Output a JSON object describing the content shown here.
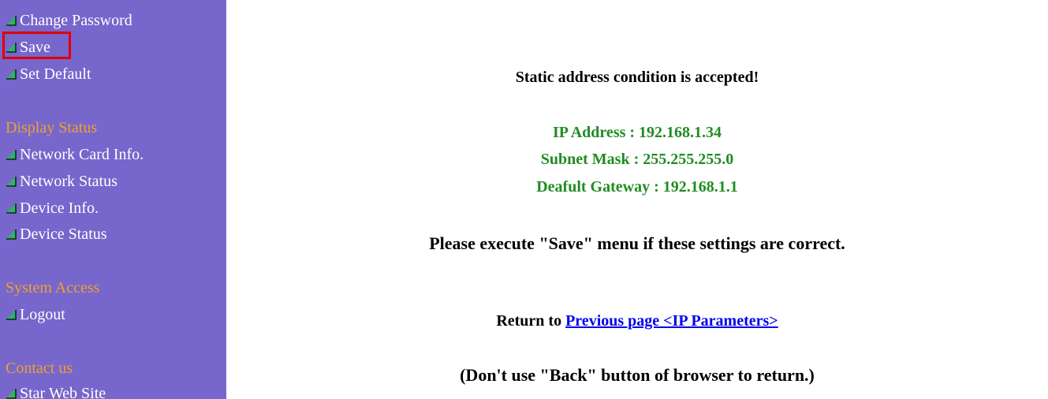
{
  "sidebar": {
    "background": "#7766cc",
    "header_color": "#f0a030",
    "bullet_icon": "green-triangle-bullet-icon",
    "items": [
      {
        "label": "Change Password"
      },
      {
        "label": "Save"
      },
      {
        "label": "Set Default"
      }
    ],
    "sections": [
      {
        "header": "Display Status",
        "items": [
          {
            "label": "Network Card Info."
          },
          {
            "label": "Network Status"
          },
          {
            "label": "Device Info."
          },
          {
            "label": "Device Status"
          }
        ]
      },
      {
        "header": "System Access",
        "items": [
          {
            "label": "Logout"
          }
        ]
      },
      {
        "header": "Contact us",
        "items": [
          {
            "label": "Star Web Site"
          }
        ]
      }
    ]
  },
  "main": {
    "status_message": "Static address condition is accepted!",
    "settings_color": "#228b22",
    "ip_address": "IP Address : 192.168.1.34",
    "subnet_mask": "Subnet Mask : 255.255.255.0",
    "default_gateway": "Deafult Gateway : 192.168.1.1",
    "save_prompt": "Please execute \"Save\" menu if these settings are correct.",
    "return_prefix": "Return to ",
    "return_link": "Previous page <IP Parameters>",
    "back_warning": "(Don't use \"Back\" button of browser to return.)"
  }
}
